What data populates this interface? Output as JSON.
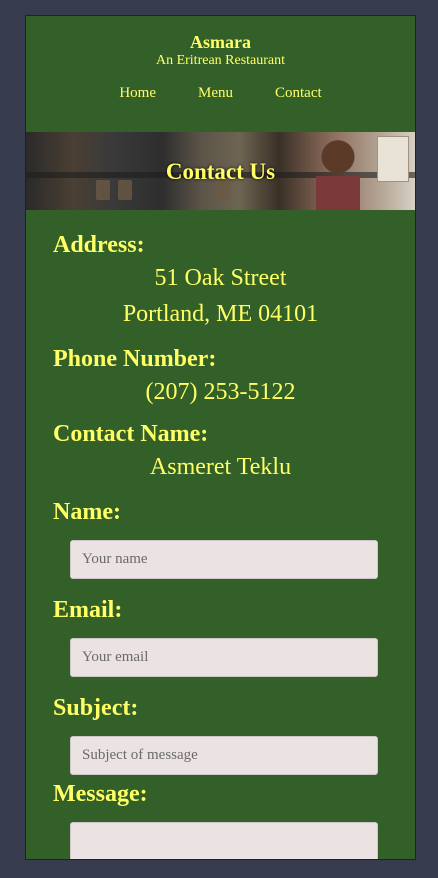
{
  "header": {
    "brand_name": "Asmara",
    "tagline": "An Eritrean Restaurant",
    "nav": [
      {
        "label": "Home"
      },
      {
        "label": "Menu"
      },
      {
        "label": "Contact"
      }
    ]
  },
  "banner": {
    "title": "Contact Us"
  },
  "contact": {
    "address_label": "Address:",
    "address_line1": "51 Oak Street",
    "address_line2": "Portland, ME 04101",
    "phone_label": "Phone Number:",
    "phone": "(207) 253-5122",
    "contact_name_label": "Contact Name:",
    "contact_name": "Asmeret Teklu"
  },
  "form": {
    "name_label": "Name:",
    "name_placeholder": "Your name",
    "email_label": "Email:",
    "email_placeholder": "Your email",
    "subject_label": "Subject:",
    "subject_placeholder": "Subject of message",
    "message_label": "Message:"
  },
  "colors": {
    "page_background": "#363b4d",
    "panel_background": "#335f29",
    "text": "#ffff66",
    "field_background": "#ebe3e3"
  }
}
